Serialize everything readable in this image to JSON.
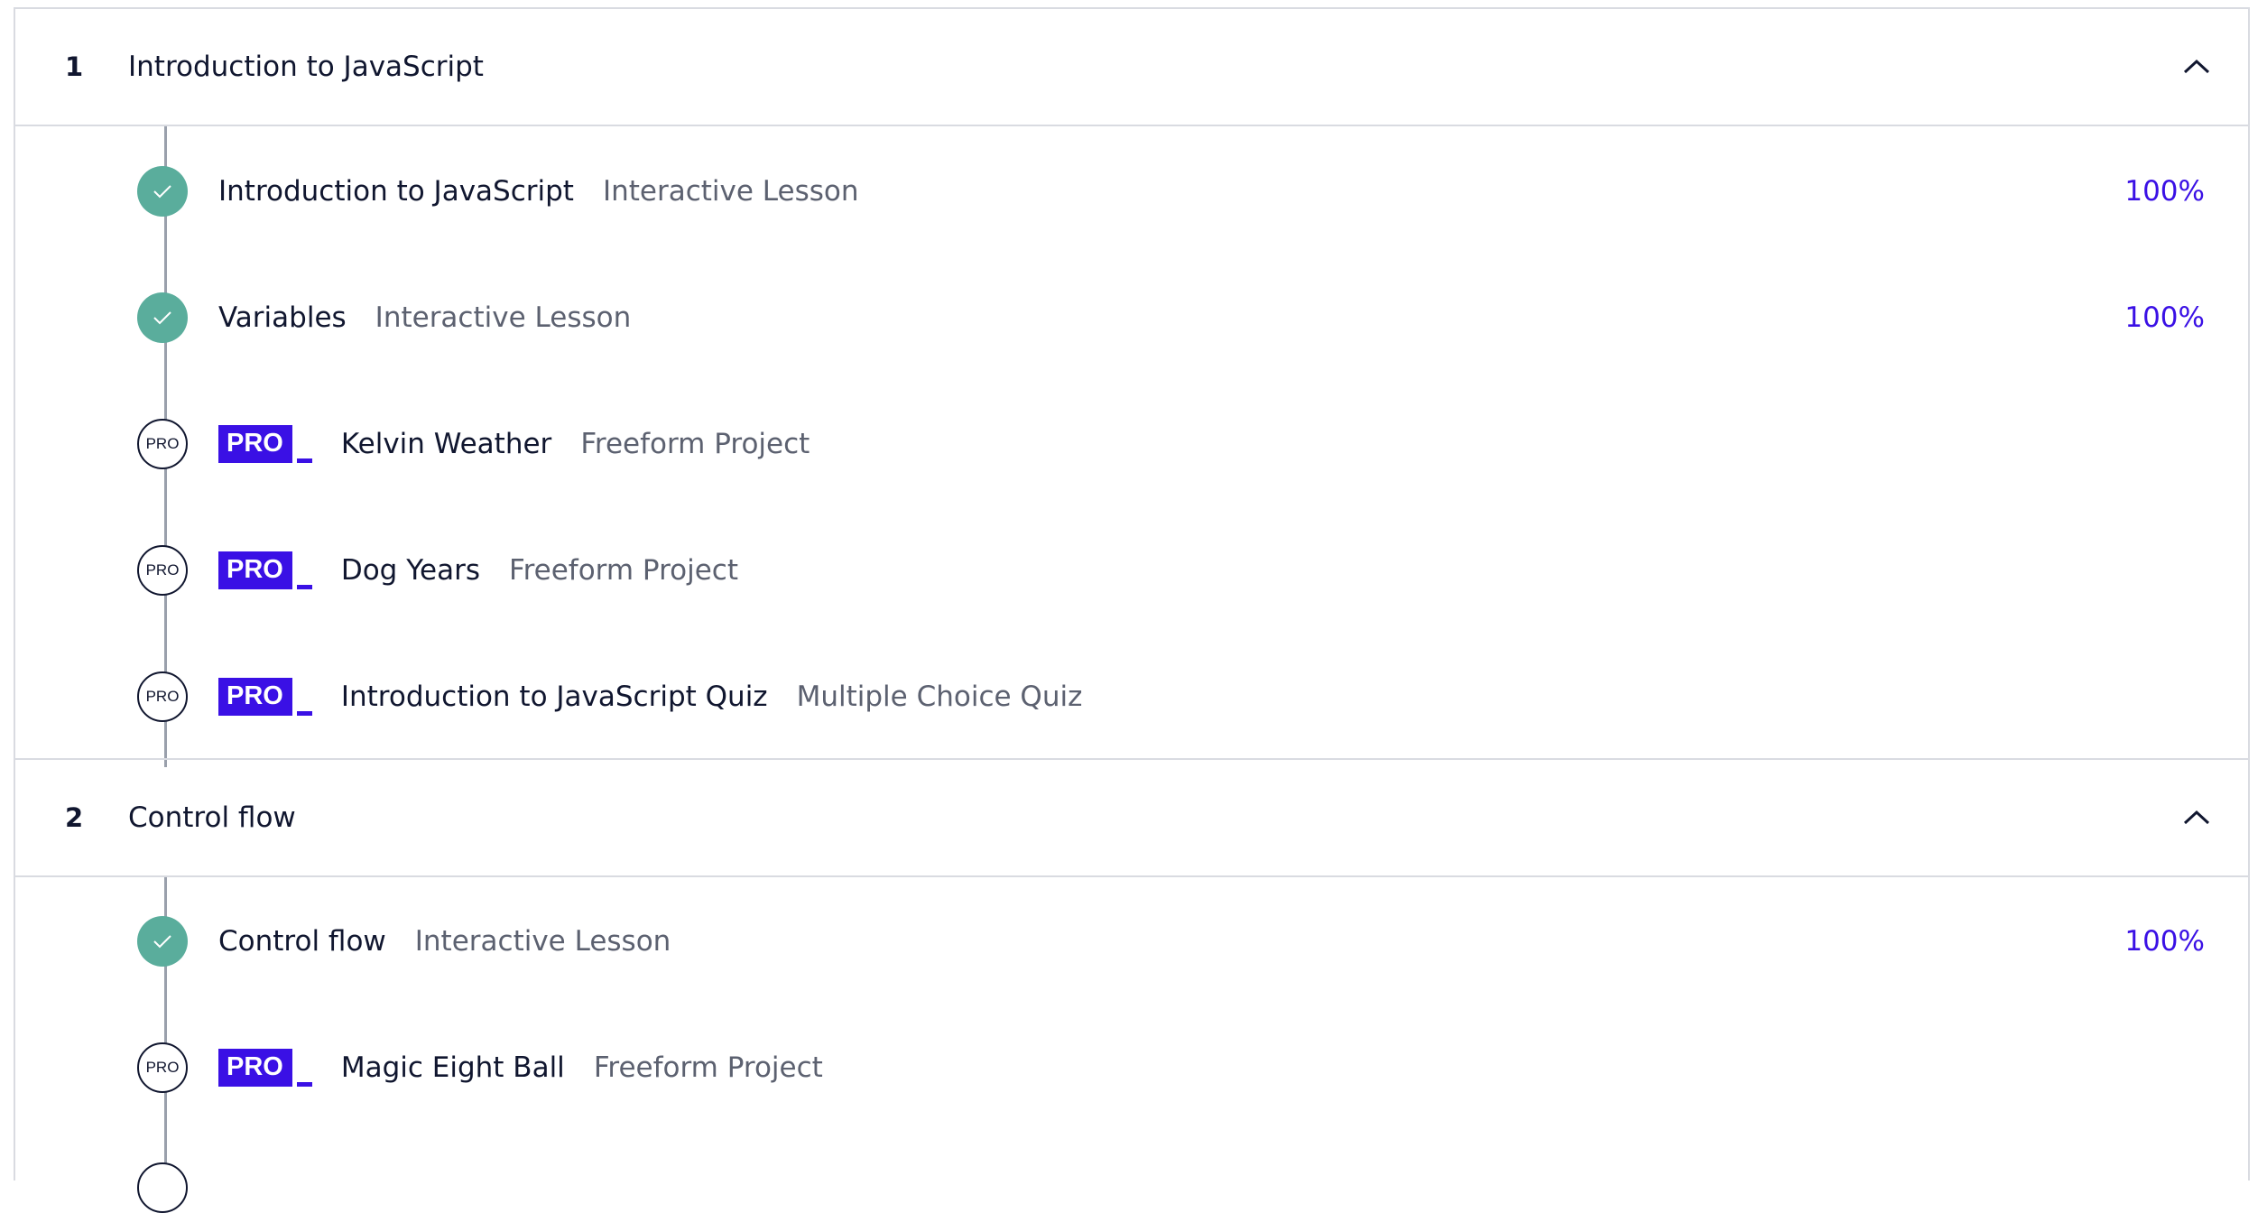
{
  "colors": {
    "accent": "#3a10e5",
    "complete": "#5aad9c",
    "text": "#10162f",
    "muted": "#5c6170",
    "border": "#d9dbe1"
  },
  "modules": [
    {
      "number": "1",
      "title": "Introduction to JavaScript",
      "expanded": true,
      "toggle_icon": "chevron-up-icon",
      "items": [
        {
          "status": "complete",
          "status_icon": "check-icon",
          "title": "Introduction to JavaScript",
          "type": "Interactive Lesson",
          "progress": "100%"
        },
        {
          "status": "complete",
          "status_icon": "check-icon",
          "title": "Variables",
          "type": "Interactive Lesson",
          "progress": "100%"
        },
        {
          "status": "pro",
          "status_label": "PRO",
          "badge": "PRO",
          "title": "Kelvin Weather",
          "type": "Freeform Project"
        },
        {
          "status": "pro",
          "status_label": "PRO",
          "badge": "PRO",
          "title": "Dog Years",
          "type": "Freeform Project"
        },
        {
          "status": "pro",
          "status_label": "PRO",
          "badge": "PRO",
          "title": "Introduction to JavaScript Quiz",
          "type": "Multiple Choice Quiz"
        }
      ]
    },
    {
      "number": "2",
      "title": "Control flow",
      "expanded": true,
      "toggle_icon": "chevron-up-icon",
      "items": [
        {
          "status": "complete",
          "status_icon": "check-icon",
          "title": "Control flow",
          "type": "Interactive Lesson",
          "progress": "100%"
        },
        {
          "status": "pro",
          "status_label": "PRO",
          "badge": "PRO",
          "title": "Magic Eight Ball",
          "type": "Freeform Project"
        }
      ]
    }
  ]
}
